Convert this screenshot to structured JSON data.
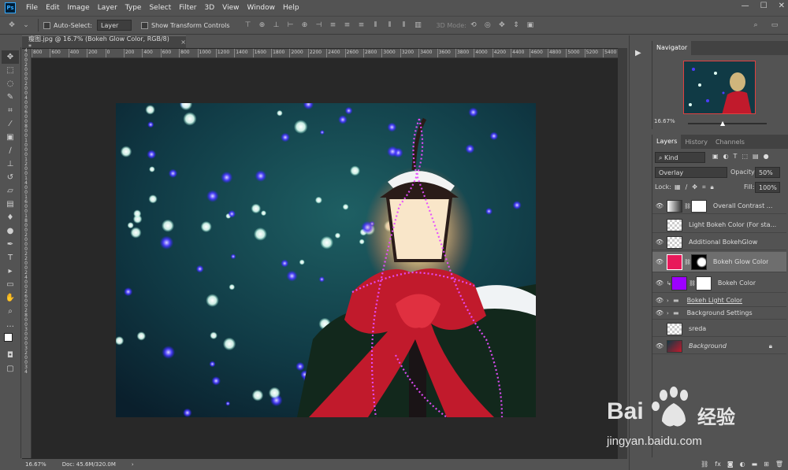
{
  "app": {
    "logo": "Ps"
  },
  "menu": [
    "File",
    "Edit",
    "Image",
    "Layer",
    "Type",
    "Select",
    "Filter",
    "3D",
    "View",
    "Window",
    "Help"
  ],
  "window_controls": {
    "minimize": "—",
    "maximize": "☐",
    "close": "✕"
  },
  "options_bar": {
    "auto_select_label": "Auto-Select:",
    "auto_select_value": "Layer",
    "show_transform_label": "Show Transform Controls",
    "mode_3d_label": "3D Mode:"
  },
  "document": {
    "tab_title": "瘦图.jpg @ 16.7% (Bokeh Glow Color, RGB/8) *",
    "close": "×"
  },
  "ruler": {
    "h_ticks": [
      "800",
      "600",
      "400",
      "200",
      "0",
      "200",
      "400",
      "600",
      "800",
      "1000",
      "1200",
      "1400",
      "1600",
      "1800",
      "2000",
      "2200",
      "2400",
      "2600",
      "2800",
      "3000",
      "3200",
      "3400",
      "3600",
      "3800",
      "4000",
      "4200",
      "4400",
      "4600",
      "4800",
      "5000",
      "5200",
      "5400"
    ],
    "v_ticks": [
      "4",
      "0",
      "0",
      "2",
      "0",
      "0",
      "0",
      "2",
      "0",
      "0",
      "4",
      "0",
      "0",
      "6",
      "0",
      "0",
      "8",
      "0",
      "0",
      "1",
      "0",
      "0",
      "0",
      "1",
      "2",
      "0",
      "0",
      "1",
      "4",
      "0",
      "0",
      "1",
      "6",
      "0",
      "0",
      "1",
      "8",
      "0",
      "0",
      "2",
      "0",
      "0",
      "0",
      "2",
      "2",
      "0",
      "0",
      "2",
      "4",
      "0",
      "0",
      "2",
      "6",
      "0",
      "0",
      "2",
      "8",
      "0",
      "0",
      "3",
      "0",
      "0",
      "0",
      "3",
      "2",
      "0",
      "0",
      "3",
      "4"
    ]
  },
  "status": {
    "zoom": "16.67%",
    "doc": "Doc: 45.6M/320.0M",
    "arrow": "›"
  },
  "navigator": {
    "tab": "Navigator",
    "zoom": "16.67%"
  },
  "layers_panel": {
    "tabs": [
      "Layers",
      "History",
      "Channels"
    ],
    "kind_label": "Kind",
    "blend_mode": "Overlay",
    "opacity_label": "Opacity:",
    "opacity_value": "50%",
    "lock_label": "Lock:",
    "fill_label": "Fill:",
    "fill_value": "100%",
    "layers": [
      {
        "name": "Overall Contrast ...",
        "visible": true,
        "type": "adjustment"
      },
      {
        "name": "Light Bokeh Color (For sta...",
        "visible": false,
        "type": "pixel"
      },
      {
        "name": "Additional BokehGlow",
        "visible": true,
        "type": "pixel"
      },
      {
        "name": "Bokeh Glow Color",
        "visible": true,
        "type": "fill-pink",
        "selected": true
      },
      {
        "name": "Bokeh Color",
        "visible": true,
        "type": "fill-purple"
      },
      {
        "name": "Bokeh Light Color",
        "visible": true,
        "type": "group"
      },
      {
        "name": "Background Settings",
        "visible": true,
        "type": "group"
      },
      {
        "name": "sreda",
        "visible": false,
        "type": "pixel"
      },
      {
        "name": "Background",
        "visible": true,
        "type": "photo",
        "locked": true
      }
    ]
  },
  "watermark": {
    "brand": "Bai",
    "brand2": "经验",
    "url": "jingyan.baidu.com"
  },
  "colors": {
    "ui_bg": "#535353",
    "canvas_bg": "#282828",
    "pink": "#e8195a",
    "purple": "#9d00ff",
    "accent": "#31a8ff"
  }
}
